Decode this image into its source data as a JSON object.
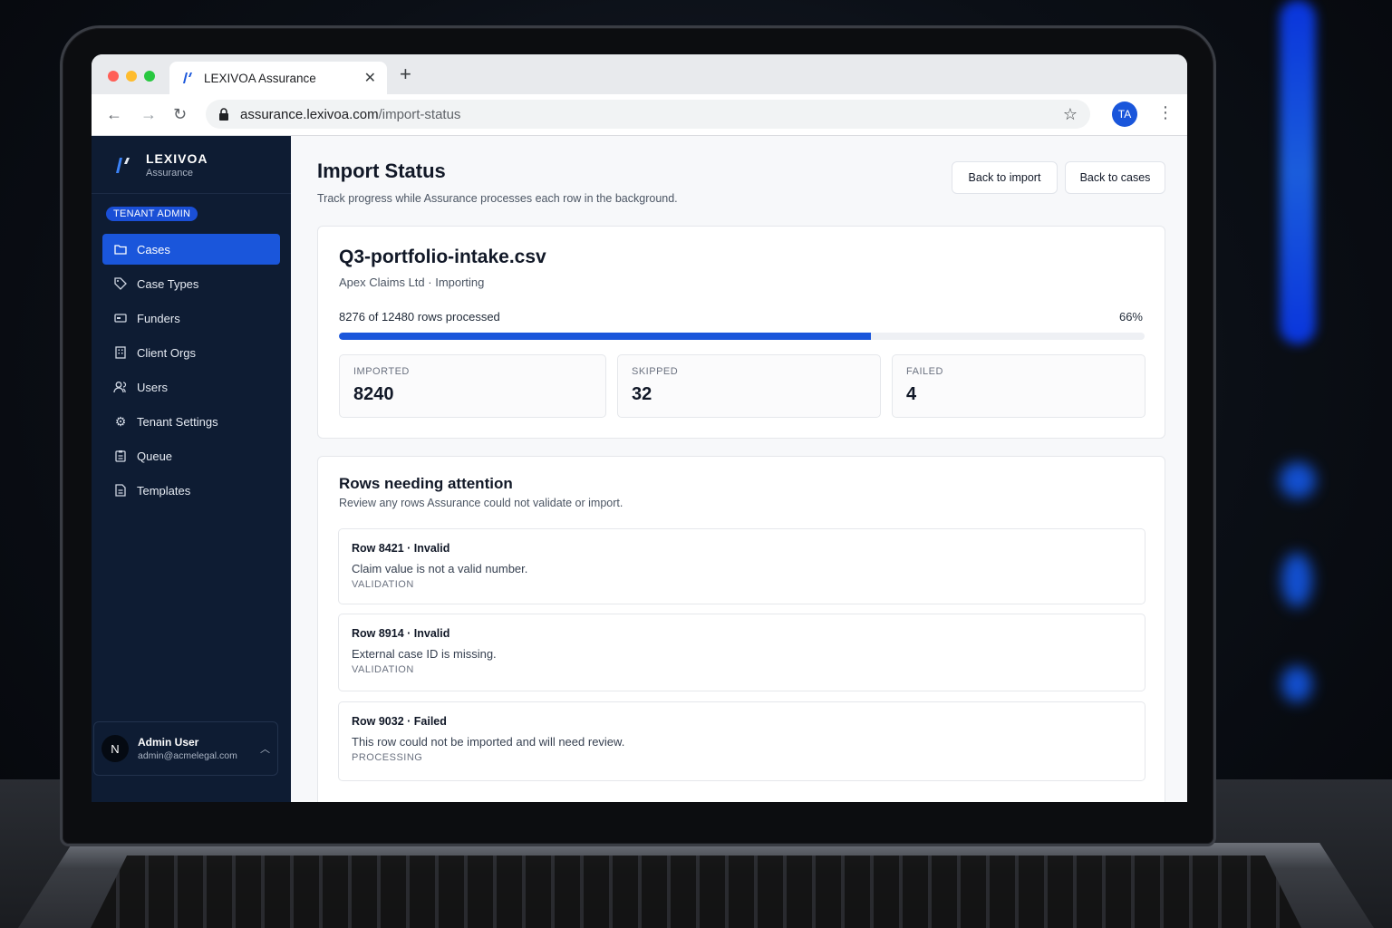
{
  "browser": {
    "tab_title": "LEXIVOA Assurance",
    "url_host": "assurance.lexivoa.com",
    "url_path": "/import-status",
    "profile_initials": "TA"
  },
  "brand": {
    "name": "LEXIVOA",
    "subtitle": "Assurance",
    "accent": "#1a56db"
  },
  "role_badge": "TENANT ADMIN",
  "sidebar": {
    "items": [
      {
        "label": "Cases",
        "icon": "folder-icon",
        "active": true
      },
      {
        "label": "Case Types",
        "icon": "tag-icon"
      },
      {
        "label": "Funders",
        "icon": "card-icon"
      },
      {
        "label": "Client Orgs",
        "icon": "building-icon"
      },
      {
        "label": "Users",
        "icon": "users-icon"
      },
      {
        "label": "Tenant Settings",
        "icon": "gear-icon"
      },
      {
        "label": "Queue",
        "icon": "clipboard-icon"
      },
      {
        "label": "Templates",
        "icon": "document-icon"
      }
    ]
  },
  "user": {
    "initial": "N",
    "name": "Admin User",
    "email": "admin@acmelegal.com"
  },
  "page": {
    "title": "Import Status",
    "subtitle": "Track progress while Assurance processes each row in the background.",
    "back_to_import": "Back to import",
    "back_to_cases": "Back to cases"
  },
  "import": {
    "file_name": "Q3-portfolio-intake.csv",
    "meta": "Apex Claims Ltd · Importing",
    "progress_label": "8276 of 12480 rows processed",
    "progress_pct_label": "66%",
    "progress_fraction": 0.66,
    "stats": [
      {
        "label": "IMPORTED",
        "value": "8240"
      },
      {
        "label": "SKIPPED",
        "value": "32"
      },
      {
        "label": "FAILED",
        "value": "4"
      }
    ]
  },
  "attention": {
    "title": "Rows needing attention",
    "subtitle": "Review any rows Assurance could not validate or import.",
    "rows": [
      {
        "title": "Row 8421 · Invalid",
        "message": "Claim value is not a valid number.",
        "tag": "VALIDATION"
      },
      {
        "title": "Row 8914 · Invalid",
        "message": "External case ID is missing.",
        "tag": "VALIDATION"
      },
      {
        "title": "Row 9032 · Failed",
        "message": "This row could not be imported and will need review.",
        "tag": "PROCESSING"
      }
    ]
  }
}
